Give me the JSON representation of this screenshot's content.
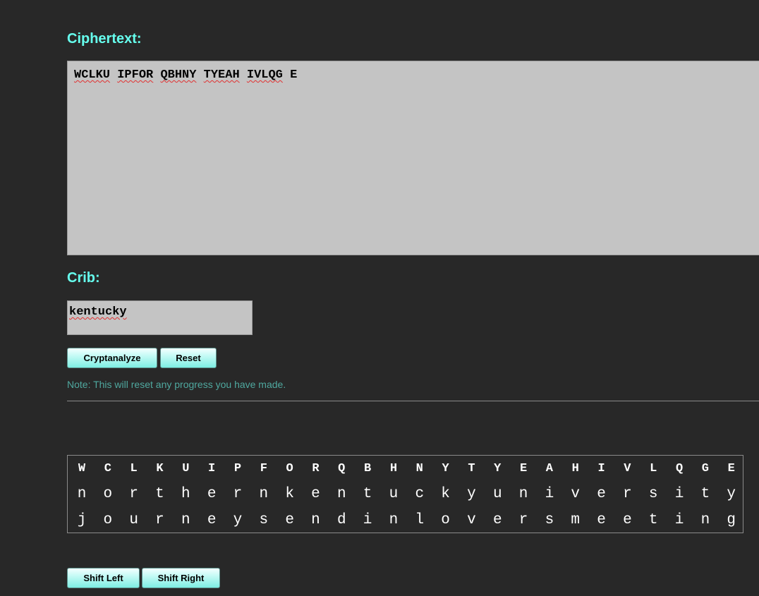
{
  "ciphertext_section": {
    "heading": "Ciphertext:",
    "groups": [
      "WCLKU",
      "IPFOR",
      "QBHNY",
      "TYEAH",
      "IVLQG",
      "E"
    ]
  },
  "crib_section": {
    "heading": "Crib:",
    "value": "kentucky"
  },
  "buttons": {
    "cryptanalyze": "Cryptanalyze",
    "reset": "Reset",
    "shift_left": "Shift Left",
    "shift_right": "Shift Right"
  },
  "note": "Note: This will reset any progress you have made.",
  "grid": {
    "cipher_row": [
      "W",
      "C",
      "L",
      "K",
      "U",
      "I",
      "P",
      "F",
      "O",
      "R",
      "Q",
      "B",
      "H",
      "N",
      "Y",
      "T",
      "Y",
      "E",
      "A",
      "H",
      "I",
      "V",
      "L",
      "Q",
      "G",
      "E"
    ],
    "crib_row": [
      "n",
      "o",
      "r",
      "t",
      "h",
      "e",
      "r",
      "n",
      "k",
      "e",
      "n",
      "t",
      "u",
      "c",
      "k",
      "y",
      "u",
      "n",
      "i",
      "v",
      "e",
      "r",
      "s",
      "i",
      "t",
      "y"
    ],
    "plain_row": [
      "j",
      "o",
      "u",
      "r",
      "n",
      "e",
      "y",
      "s",
      "e",
      "n",
      "d",
      "i",
      "n",
      "l",
      "o",
      "v",
      "e",
      "r",
      "s",
      "m",
      "e",
      "e",
      "t",
      "i",
      "n",
      "g"
    ]
  },
  "colors": {
    "background": "#282828",
    "heading": "#66ffee",
    "note": "#4fa89f",
    "textarea": "#c4c4c4"
  }
}
